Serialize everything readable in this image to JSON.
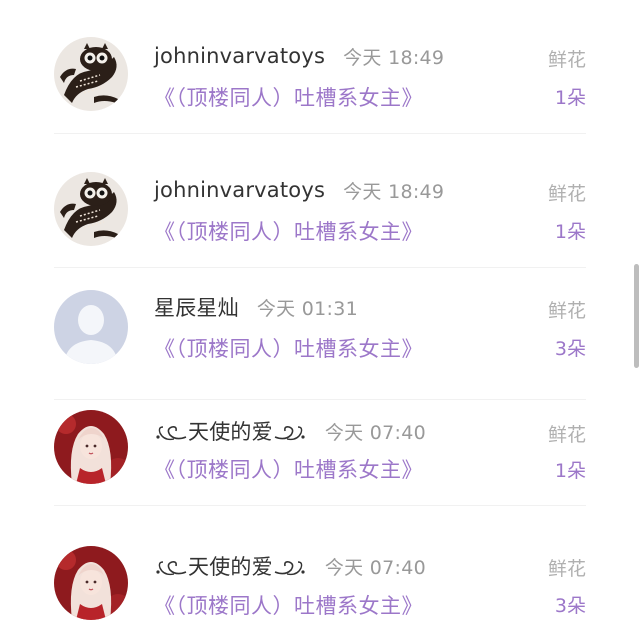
{
  "comments": [
    {
      "user": "johninvarvatoys",
      "avatar": "owl-avatar",
      "decorated": false,
      "time": "今天 18:49",
      "title": "《（顶楼同人）吐槽系女主》",
      "gift_type": "鲜花",
      "gift_count": "1朵"
    },
    {
      "user": "johninvarvatoys",
      "avatar": "owl-avatar",
      "decorated": false,
      "time": "今天 18:49",
      "title": "《（顶楼同人）吐槽系女主》",
      "gift_type": "鲜花",
      "gift_count": "1朵"
    },
    {
      "user": "星辰星灿",
      "avatar": "default-avatar",
      "decorated": false,
      "time": "今天 01:31",
      "title": "《（顶楼同人）吐槽系女主》",
      "gift_type": "鲜花",
      "gift_count": "3朵"
    },
    {
      "user": "天使的爱",
      "avatar": "girl-avatar",
      "decorated": true,
      "time": "今天 07:40",
      "title": "《（顶楼同人）吐槽系女主》",
      "gift_type": "鲜花",
      "gift_count": "1朵"
    },
    {
      "user": "天使的爱",
      "avatar": "girl-avatar",
      "decorated": true,
      "time": "今天 07:40",
      "title": "《（顶楼同人）吐槽系女主》",
      "gift_type": "鲜花",
      "gift_count": "3朵"
    }
  ],
  "colors": {
    "accent": "#9c77c9",
    "muted": "#999999",
    "username": "#333333"
  }
}
